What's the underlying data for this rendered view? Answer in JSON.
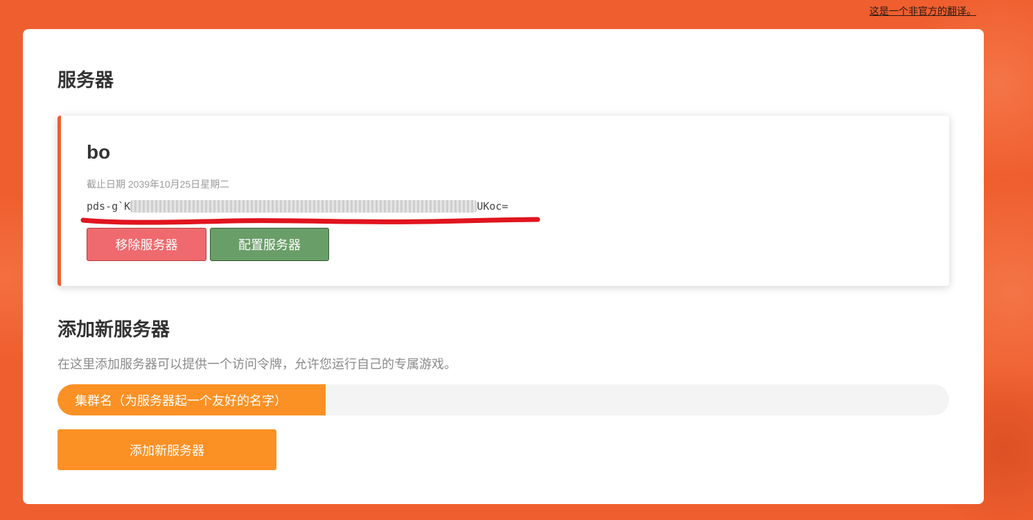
{
  "translation_note": "这是一个非官方的翻译。",
  "page": {
    "title": "服务器"
  },
  "server": {
    "name": "bo",
    "expiry": "截止日期 2039年10月25日星期二",
    "token_start": "pds-g`K",
    "token_end": "UKoc=",
    "remove_label": "移除服务器",
    "configure_label": "配置服务器"
  },
  "add_server": {
    "title": "添加新服务器",
    "description": "在这里添加服务器可以提供一个访问令牌，允许您运行自己的专属游戏。",
    "cluster_name_label": "集群名（为服务器起一个友好的名字）",
    "cluster_name_value": "",
    "submit_label": "添加新服务器"
  },
  "colors": {
    "background": "#ef5e2e",
    "accent_orange": "#fb9124",
    "remove_red": "#ef6a6e",
    "configure_green": "#6a9e68",
    "annotation_red": "#e0141e"
  }
}
